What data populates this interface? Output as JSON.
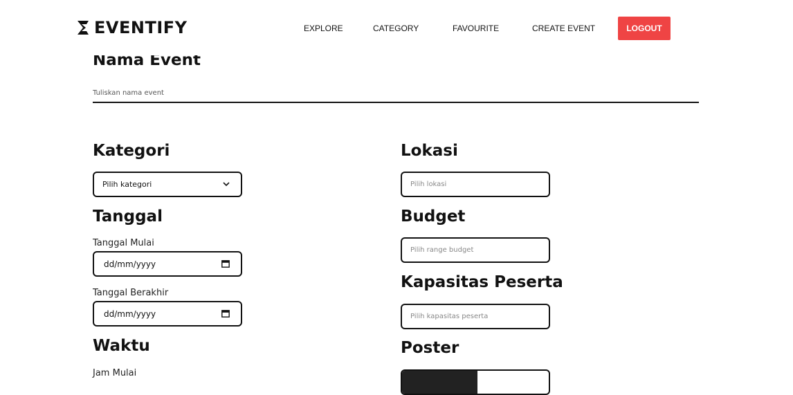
{
  "brand": {
    "name": "EVENTIFY",
    "icon": "eventify-logo-icon"
  },
  "nav": {
    "items": [
      {
        "label": "EXPLORE"
      },
      {
        "label": "CATEGORY"
      },
      {
        "label": "FAVOURITE"
      },
      {
        "label": "CREATE EVENT"
      }
    ],
    "logout_label": "LOGOUT",
    "logout_color": "#ef4444"
  },
  "form": {
    "name": {
      "title": "Nama Event",
      "placeholder": "Tuliskan nama event"
    },
    "category": {
      "title": "Kategori",
      "selected": "Pilih kategori"
    },
    "date": {
      "title": "Tanggal",
      "start_label": "Tanggal Mulai",
      "start_value": "dd/mm/yyyy",
      "end_label": "Tanggal Berakhir",
      "end_value": "dd/mm/yyyy"
    },
    "time": {
      "title": "Waktu",
      "start_label": "Jam Mulai"
    },
    "location": {
      "title": "Lokasi",
      "placeholder": "Pilih lokasi"
    },
    "budget": {
      "title": "Budget",
      "placeholder": "Pilih range budget"
    },
    "capacity": {
      "title": "Kapasitas Peserta",
      "placeholder": "Pilih kapasitas peserta"
    },
    "poster": {
      "title": "Poster"
    }
  }
}
